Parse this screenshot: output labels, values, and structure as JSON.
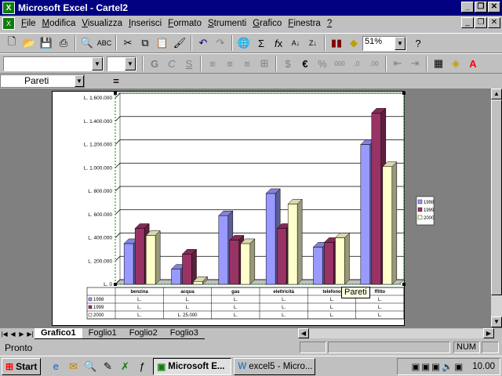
{
  "window": {
    "title": "Microsoft Excel - Cartel2"
  },
  "menu": [
    "File",
    "Modifica",
    "Visualizza",
    "Inserisci",
    "Formato",
    "Strumenti",
    "Grafico",
    "Finestra",
    "?"
  ],
  "toolbar": {
    "zoom": "51%",
    "font_combo": "",
    "size_combo": ""
  },
  "formula": {
    "namebox": "Pareti",
    "equals": "="
  },
  "chart_data": {
    "type": "bar",
    "categories": [
      "benzina",
      "acqua",
      "gas",
      "elettricità",
      "telefono",
      "affitto"
    ],
    "series": [
      {
        "name": "1998",
        "values": [
          350000,
          130000,
          590000,
          780000,
          320000,
          1200000
        ],
        "color": "#9999ff"
      },
      {
        "name": "1999",
        "values": [
          480000,
          260000,
          380000,
          480000,
          360000,
          1470000
        ],
        "color": "#993366"
      },
      {
        "name": "2000",
        "values": [
          420000,
          25000,
          350000,
          690000,
          400000,
          1010000
        ],
        "color": "#ffffcc"
      }
    ],
    "ylim": [
      0,
      1600000
    ],
    "yticks": [
      "L. 0",
      "L. 200.000",
      "L. 400.000",
      "L. 600.000",
      "L. 800.000",
      "L. 1.000.000",
      "L. 1.200.000",
      "L. 1.400.000",
      "L. 1.600.000"
    ],
    "grid": true,
    "legend": "right",
    "legend_labels": [
      "1998",
      "1999",
      "2000"
    ],
    "table": [
      {
        "series": "1998",
        "cells": [
          "L.",
          "L.",
          "L.",
          "L.",
          "L.",
          "L."
        ]
      },
      {
        "series": "1999",
        "cells": [
          "L.",
          "L.",
          "L.",
          "L.",
          "L.",
          "L."
        ]
      },
      {
        "series": "2000",
        "cells": [
          "L.",
          "L. 25.000",
          "L.",
          "L.",
          "L.",
          "L."
        ]
      }
    ],
    "category_labels_shown": [
      "benzina",
      "acqua",
      "gas",
      "elettricità",
      "telefono",
      "ffitto"
    ]
  },
  "tooltip": "Pareti",
  "tabs": [
    "Grafico1",
    "Foglio1",
    "Foglio2",
    "Foglio3"
  ],
  "status": {
    "text": "Pronto",
    "num": "NUM"
  },
  "taskbar": {
    "start": "Start",
    "tasks": [
      "Microsoft E...",
      "excel5 - Micro..."
    ],
    "clock": "10.00"
  }
}
